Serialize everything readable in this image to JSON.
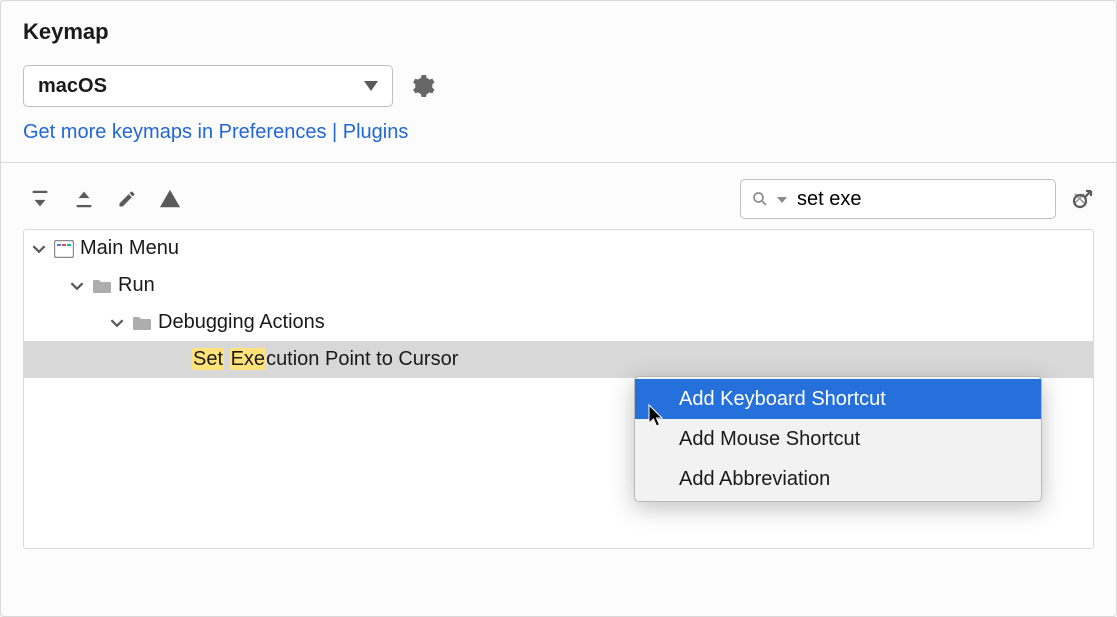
{
  "header": {
    "title": "Keymap"
  },
  "keymap_select": {
    "value": "macOS"
  },
  "link": {
    "text": "Get more keymaps in Preferences | Plugins"
  },
  "search": {
    "placeholder": "",
    "value": "set exe"
  },
  "tree": {
    "main_menu": {
      "label": "Main Menu"
    },
    "run": {
      "label": "Run"
    },
    "debugging": {
      "label": "Debugging Actions"
    },
    "action": {
      "hl1": "Set",
      "hl2": "Exe",
      "rest": "cution Point to Cursor"
    }
  },
  "context_menu": {
    "item1": "Add Keyboard Shortcut",
    "item2": "Add Mouse Shortcut",
    "item3": "Add Abbreviation"
  }
}
